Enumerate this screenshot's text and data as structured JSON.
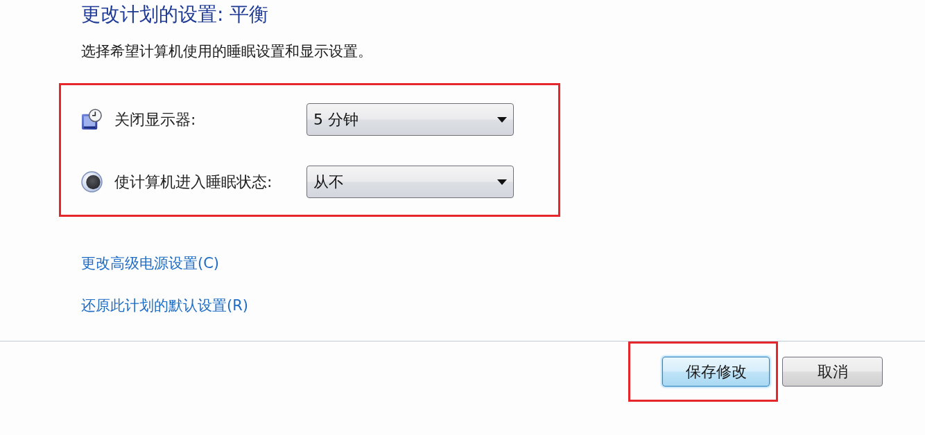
{
  "page": {
    "title": "更改计划的设置: 平衡",
    "subtitle": "选择希望计算机使用的睡眠设置和显示设置。"
  },
  "settings": {
    "highlighted": true,
    "rows": [
      {
        "kind": "display",
        "label": "关闭显示器:",
        "value": "5 分钟"
      },
      {
        "kind": "sleep",
        "label": "使计算机进入睡眠状态:",
        "value": "从不"
      }
    ]
  },
  "links": [
    "更改高级电源设置(C)",
    "还原此计划的默认设置(R)"
  ],
  "buttons": [
    {
      "label": "保存修改",
      "default": true,
      "highlighted": true
    },
    {
      "label": "取消",
      "default": false,
      "highlighted": false
    }
  ]
}
